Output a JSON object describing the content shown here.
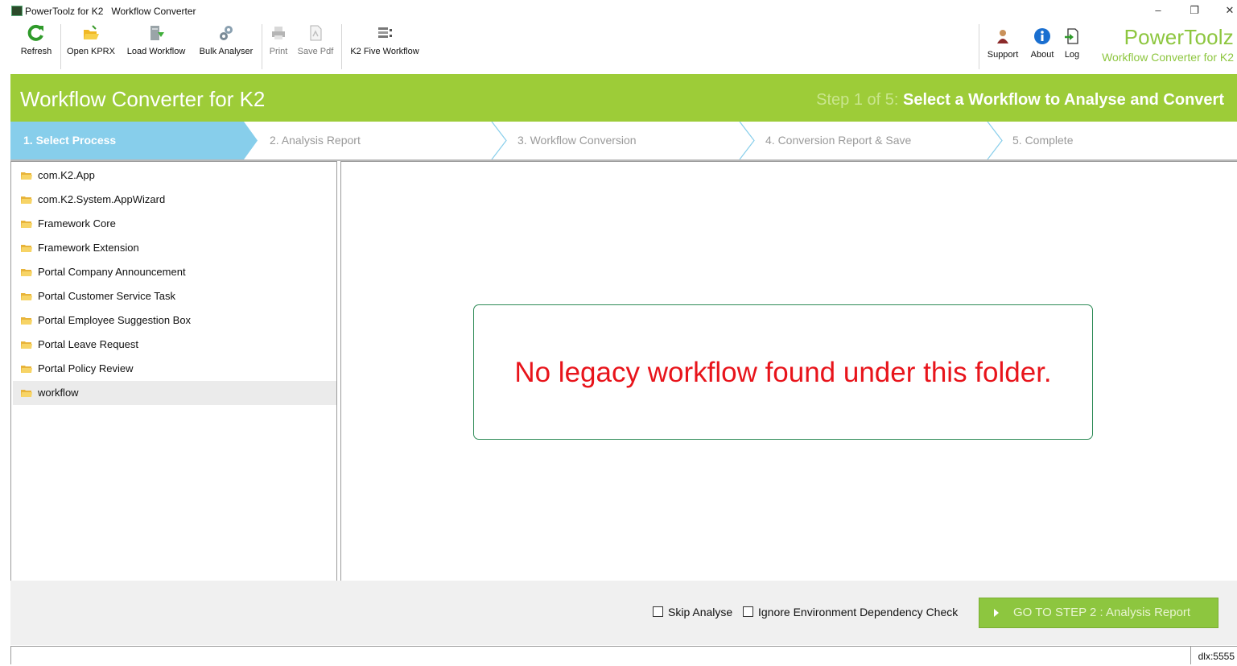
{
  "window": {
    "title": "PowerToolz for K2   Workflow Converter",
    "minimize": "–",
    "restore": "❐",
    "close": "✕"
  },
  "toolbar": {
    "buttons": [
      {
        "label": "Refresh",
        "icon": "refresh-icon"
      },
      {
        "label": "Open KPRX",
        "icon": "folder-open-icon"
      },
      {
        "label": "Load Workflow",
        "icon": "database-load-icon"
      },
      {
        "label": "Bulk Analyser",
        "icon": "gears-icon"
      },
      {
        "label": "Print",
        "icon": "printer-icon",
        "disabled": true
      },
      {
        "label": "Save Pdf",
        "icon": "pdf-icon",
        "disabled": true
      },
      {
        "label": "K2 Five Workflow",
        "icon": "workflow-grid-icon"
      }
    ],
    "right_buttons": [
      {
        "label": "Support",
        "icon": "support-person-icon"
      },
      {
        "label": "About",
        "icon": "info-icon"
      },
      {
        "label": "Log",
        "icon": "log-file-icon"
      }
    ],
    "brand": {
      "name": "PowerToolz",
      "subtitle": "Workflow Converter for K2"
    }
  },
  "header": {
    "title": "Workflow Converter for K2",
    "step_prefix": "Step 1 of 5: ",
    "step_title": "Select a Workflow to Analyse and Convert"
  },
  "steps": [
    {
      "label": "1. Select Process",
      "active": true
    },
    {
      "label": "2. Analysis Report",
      "active": false
    },
    {
      "label": "3. Workflow Conversion",
      "active": false
    },
    {
      "label": "4. Conversion Report & Save",
      "active": false
    },
    {
      "label": "5. Complete",
      "active": false
    }
  ],
  "tree": {
    "items": [
      {
        "label": "com.K2.App"
      },
      {
        "label": "com.K2.System.AppWizard"
      },
      {
        "label": "Framework Core"
      },
      {
        "label": "Framework Extension"
      },
      {
        "label": "Portal Company Announcement"
      },
      {
        "label": "Portal Customer Service Task"
      },
      {
        "label": "Portal Employee Suggestion Box"
      },
      {
        "label": "Portal Leave Request"
      },
      {
        "label": "Portal Policy Review"
      },
      {
        "label": "workflow",
        "selected": true
      }
    ]
  },
  "main": {
    "message": "No legacy workflow found under this folder."
  },
  "bottom": {
    "skip_analyse": {
      "label": "Skip Analyse",
      "checked": false
    },
    "ignore_env": {
      "label": "Ignore Environment Dependency Check",
      "checked": false
    },
    "go_button": "GO TO STEP 2 : Analysis Report"
  },
  "status": {
    "server": "dlx:5555"
  },
  "colors": {
    "brand_green": "#8dc63f",
    "header_green": "#9dcc38",
    "active_step_blue": "#87ceeb",
    "message_red": "#e8141b",
    "message_border": "#2e8b57"
  }
}
